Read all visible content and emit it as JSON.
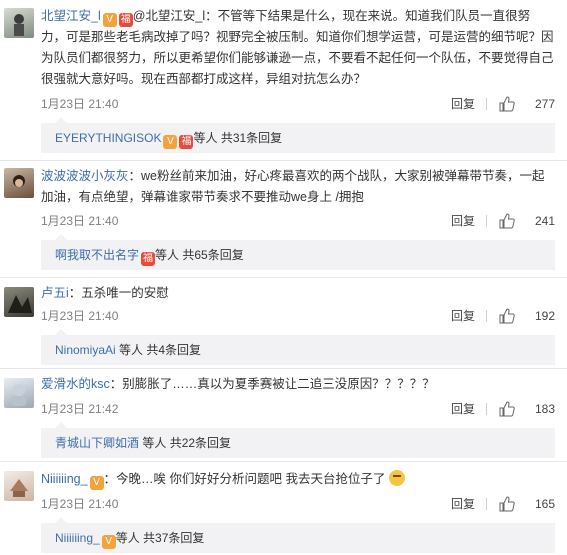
{
  "comments": [
    {
      "username": "北望江安_l",
      "content": "@北望江安_l：不管等下结果是什么，现在来说。知道我们队员一直很努力，可是那些老毛病改掉了吗？视野完全被压制。知道你们想学运营，可是运营的细节呢？因为队员们都很努力，所以更希望你们能够谦逊一点，不要看不起任何一个队伍，不要觉得自己很强就大意好吗。现在西部都打成这样，异组对抗怎么办？",
      "time": "1月23日 21:40",
      "reply_label": "回复",
      "likes": "277",
      "sub_user": "EYERYTHINGISOK",
      "sub_text": "等人 共31条回复"
    },
    {
      "username": "波波波波小灰灰",
      "content": "：we粉丝前来加油，好心疼最喜欢的两个战队，大家别被弹幕带节奏，一起加油，有点绝望，弹幕谁家带节奏求不要推动we身上 /拥抱",
      "time": "1月23日 21:40",
      "reply_label": "回复",
      "likes": "241",
      "sub_user": "啊我取不出名字",
      "sub_text": "等人 共65条回复"
    },
    {
      "username": "卢五i",
      "content": "：五杀唯一的安慰",
      "time": "1月23日 21:40",
      "reply_label": "回复",
      "likes": "192",
      "sub_user": "NinomiyaAi",
      "sub_text": "等人 共4条回复"
    },
    {
      "username": "爱滑水的ksc",
      "content": "：别膨胀了……真以为夏季赛被让二追三没原因？？？？？",
      "time": "1月23日 21:42",
      "reply_label": "回复",
      "likes": "183",
      "sub_user": "青城山下卿如酒",
      "sub_text": "等人 共22条回复"
    },
    {
      "username": "Niiiiiing_",
      "content": "：今晚…唉 你们好好分析问题吧 我去天台抢位子了",
      "time": "1月23日 21:40",
      "reply_label": "回复",
      "likes": "165",
      "sub_user": "Niiiiiing_",
      "sub_text": "等人 共37条回复"
    }
  ],
  "colors": {
    "link": "#3d6ea8",
    "meta": "#808080",
    "subbar_bg": "#f2f2f5"
  },
  "icons": {
    "like": "thumbs-up-icon",
    "vip": "vip-badge-icon",
    "red": "red-envelope-badge-icon"
  }
}
